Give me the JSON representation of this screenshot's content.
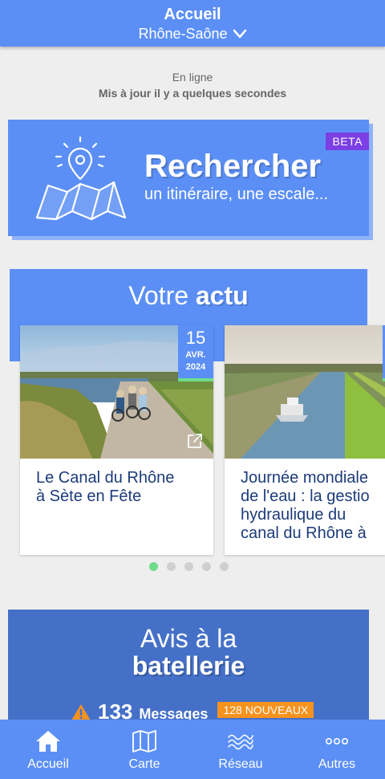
{
  "header": {
    "title": "Accueil",
    "region": "Rhône-Saône"
  },
  "sync": {
    "status": "En ligne",
    "updated": "Mis à jour il y a quelques secondes"
  },
  "search": {
    "badge": "BETA",
    "title": "Rechercher",
    "subtitle": "un itinéraire, une escale..."
  },
  "actu": {
    "title_prefix": "Votre",
    "title_strong": "actu",
    "cards": [
      {
        "day": "15",
        "month": "AVR.",
        "year": "2024",
        "headline": "Le Canal du Rhône\nà Sète en Fête"
      },
      {
        "headline": "Journée mondiale\nde l'eau : la gestio\nhydraulique du\ncanal du Rhône à"
      }
    ],
    "carousel": {
      "active": 0,
      "count": 5
    }
  },
  "avis": {
    "line1": "Avis à la",
    "line2": "batellerie",
    "count": "133",
    "label": "Messages",
    "new_badge": "128 NOUVEAUX"
  },
  "nav": [
    {
      "label": "Accueil",
      "icon": "home-icon"
    },
    {
      "label": "Carte",
      "icon": "map-icon"
    },
    {
      "label": "Réseau",
      "icon": "waves-icon"
    },
    {
      "label": "Autres",
      "icon": "more-icon"
    }
  ],
  "colors": {
    "primary": "#5b8ff5",
    "avis": "#4570c7",
    "beta": "#7b3fe4",
    "accent_green": "#6fdc8c",
    "badge_orange": "#f6921e",
    "headline": "#1d3b7a"
  }
}
